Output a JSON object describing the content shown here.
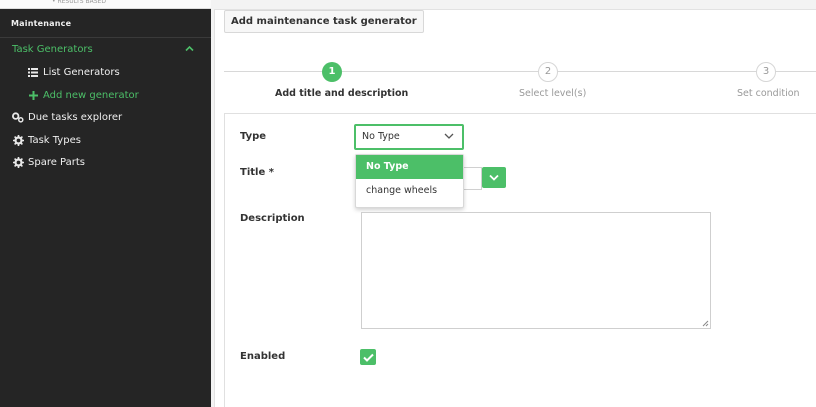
{
  "sidebar": {
    "top_cut_text": "• RESULTS BASED",
    "section_title": "Maintenance",
    "items": [
      {
        "label": "Task Generators",
        "icon": "chevron-up-icon"
      },
      {
        "label": "List Generators",
        "icon": "list-icon"
      },
      {
        "label": "Add new generator",
        "icon": "plus-icon"
      },
      {
        "label": "Due tasks explorer",
        "icon": "gears-icon"
      },
      {
        "label": "Task Types",
        "icon": "gear-icon"
      },
      {
        "label": "Spare Parts",
        "icon": "gear-icon"
      }
    ]
  },
  "header": {
    "title": "Add maintenance task generator"
  },
  "stepper": {
    "steps": [
      {
        "number": "1",
        "label": "Add title and description",
        "active": true
      },
      {
        "number": "2",
        "label": "Select level(s)",
        "active": false
      },
      {
        "number": "3",
        "label": "Set condition",
        "active": false
      }
    ]
  },
  "form": {
    "type_label": "Type",
    "type_value": "No Type",
    "type_options": [
      "No Type",
      "change wheels"
    ],
    "title_label": "Title *",
    "description_label": "Description",
    "enabled_label": "Enabled",
    "enabled": true
  },
  "colors": {
    "accent": "#4cbf68",
    "sidebar_bg": "#252525"
  }
}
